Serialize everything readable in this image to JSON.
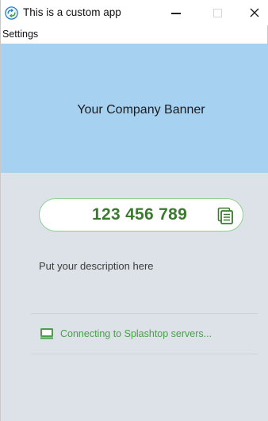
{
  "window": {
    "title": "This is a custom app",
    "controls": {
      "minimize_icon": "minimize-icon",
      "maximize_icon": "maximize-icon",
      "close_icon": "close-icon",
      "close_glyph": "✕"
    }
  },
  "menubar": {
    "items": [
      {
        "label": "Settings"
      }
    ]
  },
  "banner": {
    "text": "Your Company Banner",
    "color": "#a6d1f0"
  },
  "main": {
    "background": "#dde1e8",
    "session_id": "123 456 789",
    "copy_icon": "copy-icon",
    "description": "Put your description here",
    "status": {
      "icon": "monitor-icon",
      "text": "Connecting to Splashtop servers..."
    },
    "accent_color": "#3a7a2f",
    "status_color": "#49a048"
  }
}
